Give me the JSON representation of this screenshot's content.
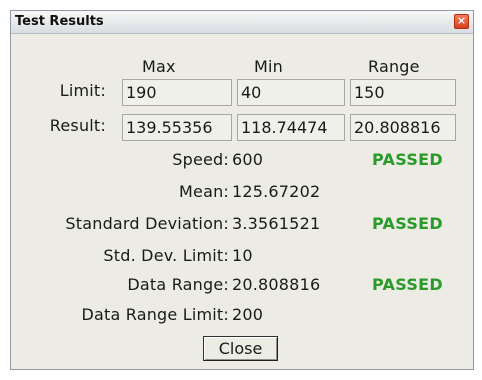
{
  "window": {
    "title": "Test Results",
    "close_glyph": "×"
  },
  "columns": {
    "max": "Max",
    "min": "Min",
    "range": "Range"
  },
  "rows": {
    "limit": {
      "label": "Limit:",
      "max": "190",
      "min": "40",
      "range": "150"
    },
    "result": {
      "label": "Result:",
      "max": "139.55356",
      "min": "118.74474",
      "range": "20.808816"
    }
  },
  "stats": {
    "speed": {
      "label": "Speed:",
      "value": "600",
      "status": "PASSED"
    },
    "mean": {
      "label": "Mean:",
      "value": "125.67202"
    },
    "std_dev": {
      "label": "Standard Deviation:",
      "value": "3.3561521",
      "status": "PASSED"
    },
    "std_dev_limit": {
      "label": "Std. Dev. Limit:",
      "value": "10"
    },
    "data_range": {
      "label": "Data Range:",
      "value": "20.808816",
      "status": "PASSED"
    },
    "data_range_limit": {
      "label": "Data Range Limit:",
      "value": "200"
    }
  },
  "buttons": {
    "close": "Close"
  },
  "colors": {
    "passed": "#2a9a2a",
    "close_icon": "#d84020"
  },
  "icons": {
    "close": "close-icon"
  }
}
